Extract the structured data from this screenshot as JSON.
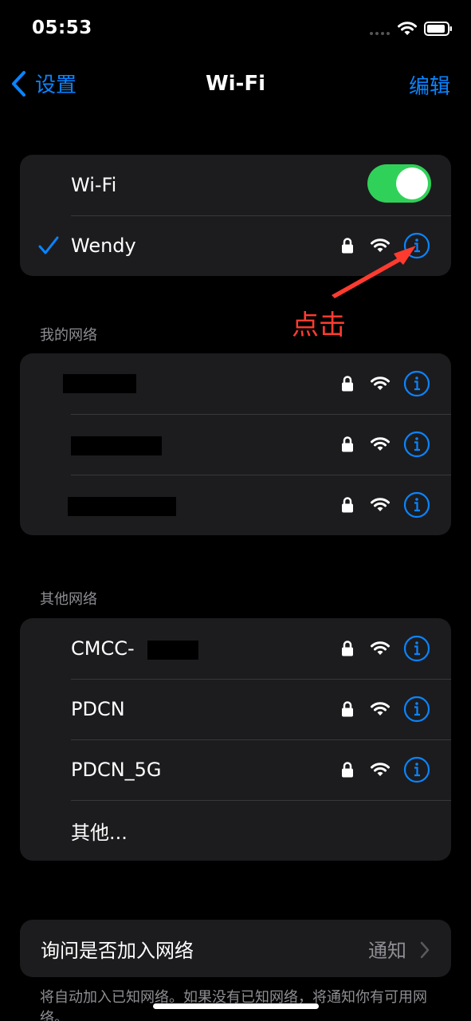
{
  "status_bar": {
    "time": "05:53"
  },
  "nav": {
    "back_label": "设置",
    "title": "Wi-Fi",
    "edit_label": "编辑"
  },
  "current": {
    "wifi_label": "Wi-Fi",
    "wifi_enabled": true,
    "connected_network": "Wendy"
  },
  "annotation": {
    "text": "点击",
    "color": "#ff3b30"
  },
  "my_networks": {
    "header": "我的网络",
    "items": [
      {
        "name": "",
        "secured": true
      },
      {
        "name": "",
        "secured": true
      },
      {
        "name": "",
        "secured": true
      }
    ]
  },
  "other_networks": {
    "header": "其他网络",
    "items": [
      {
        "name": "CMCC-",
        "secured": true
      },
      {
        "name": "PDCN",
        "secured": true
      },
      {
        "name": "PDCN_5G",
        "secured": true
      }
    ],
    "other_label": "其他..."
  },
  "ask_to_join": {
    "label": "询问是否加入网络",
    "value": "通知"
  },
  "footer_note": "将自动加入已知网络。如果没有已知网络，将通知你有可用网络。",
  "colors": {
    "accent": "#0a84ff",
    "toggle_on": "#30d158",
    "background": "#000000",
    "cell": "#1c1c1e"
  },
  "icons": [
    "chevron-left-icon",
    "checkmark-icon",
    "lock-icon",
    "wifi-icon",
    "info-icon",
    "chevron-right-icon"
  ]
}
